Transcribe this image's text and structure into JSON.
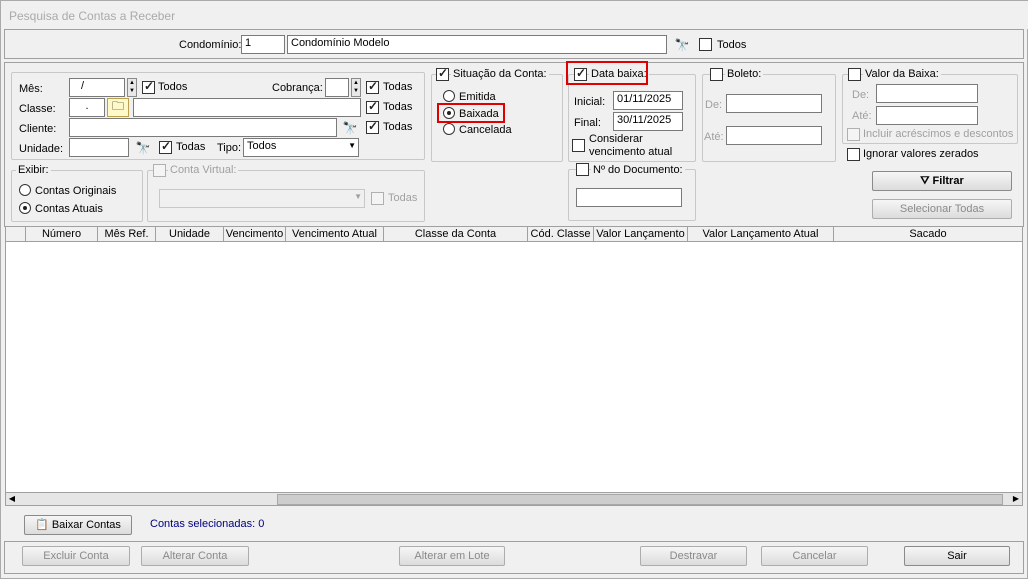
{
  "window": {
    "title": "Pesquisa de Contas a Receber"
  },
  "condominio": {
    "label": "Condomínio:",
    "code": "1",
    "name": "Condomínio Modelo",
    "todos_label": "Todos"
  },
  "filters": {
    "mes_label": "Mês:",
    "mes_value": "/",
    "mes_todos": "Todos",
    "cobranca_label": "Cobrança:",
    "cobranca_todas": "Todas",
    "classe_label": "Classe:",
    "classe_value": ".",
    "classe_todas": "Todas",
    "cliente_label": "Cliente:",
    "cliente_todas": "Todas",
    "unidade_label": "Unidade:",
    "unidade_todas": "Todas",
    "tipo_label": "Tipo:",
    "tipo_value": "Todos"
  },
  "situacao": {
    "label": "Situação da Conta:",
    "options": [
      "Emitida",
      "Baixada",
      "Cancelada"
    ],
    "selected": "Baixada"
  },
  "data_baixa": {
    "label": "Data baixa:",
    "inicial_label": "Inicial:",
    "inicial": "01/11/2025",
    "final_label": "Final:",
    "final": "30/11/2025",
    "considerar_line1": "Considerar",
    "considerar_line2": "vencimento atual"
  },
  "boleto": {
    "label": "Boleto:",
    "de_label": "De:",
    "ate_label": "Até:"
  },
  "valor_baixa": {
    "label": "Valor da Baixa:",
    "de_label": "De:",
    "ate_label": "Até:",
    "incluir_label": "Incluir acréscimos e descontos",
    "ignorar_label": "Ignorar valores zerados"
  },
  "exibir": {
    "label": "Exibir:",
    "options": [
      "Contas Originais",
      "Contas Atuais"
    ],
    "selected": "Contas Atuais"
  },
  "conta_virtual": {
    "label": "Conta Virtual:",
    "todas_label": "Todas"
  },
  "documento": {
    "label": "Nº do Documento:"
  },
  "actions": {
    "filtrar": "Filtrar",
    "selecionar_todas": "Selecionar Todas"
  },
  "grid": {
    "columns": [
      "Número",
      "Mês Ref.",
      "Unidade",
      "Vencimento",
      "Vencimento Atual",
      "Classe da Conta",
      "Cód. Classe",
      "Valor Lançamento",
      "Valor Lançamento Atual",
      "Sacado"
    ]
  },
  "bottom": {
    "baixar_contas": "Baixar Contas",
    "contas_selecionadas": "Contas selecionadas: 0"
  },
  "footer": {
    "excluir": "Excluir Conta",
    "alterar": "Alterar Conta",
    "alterar_lote": "Alterar em Lote",
    "destravar": "Destravar",
    "cancelar": "Cancelar",
    "sair": "Sair"
  },
  "colors": {
    "highlight": "#e00000",
    "link_text": "#000080"
  }
}
